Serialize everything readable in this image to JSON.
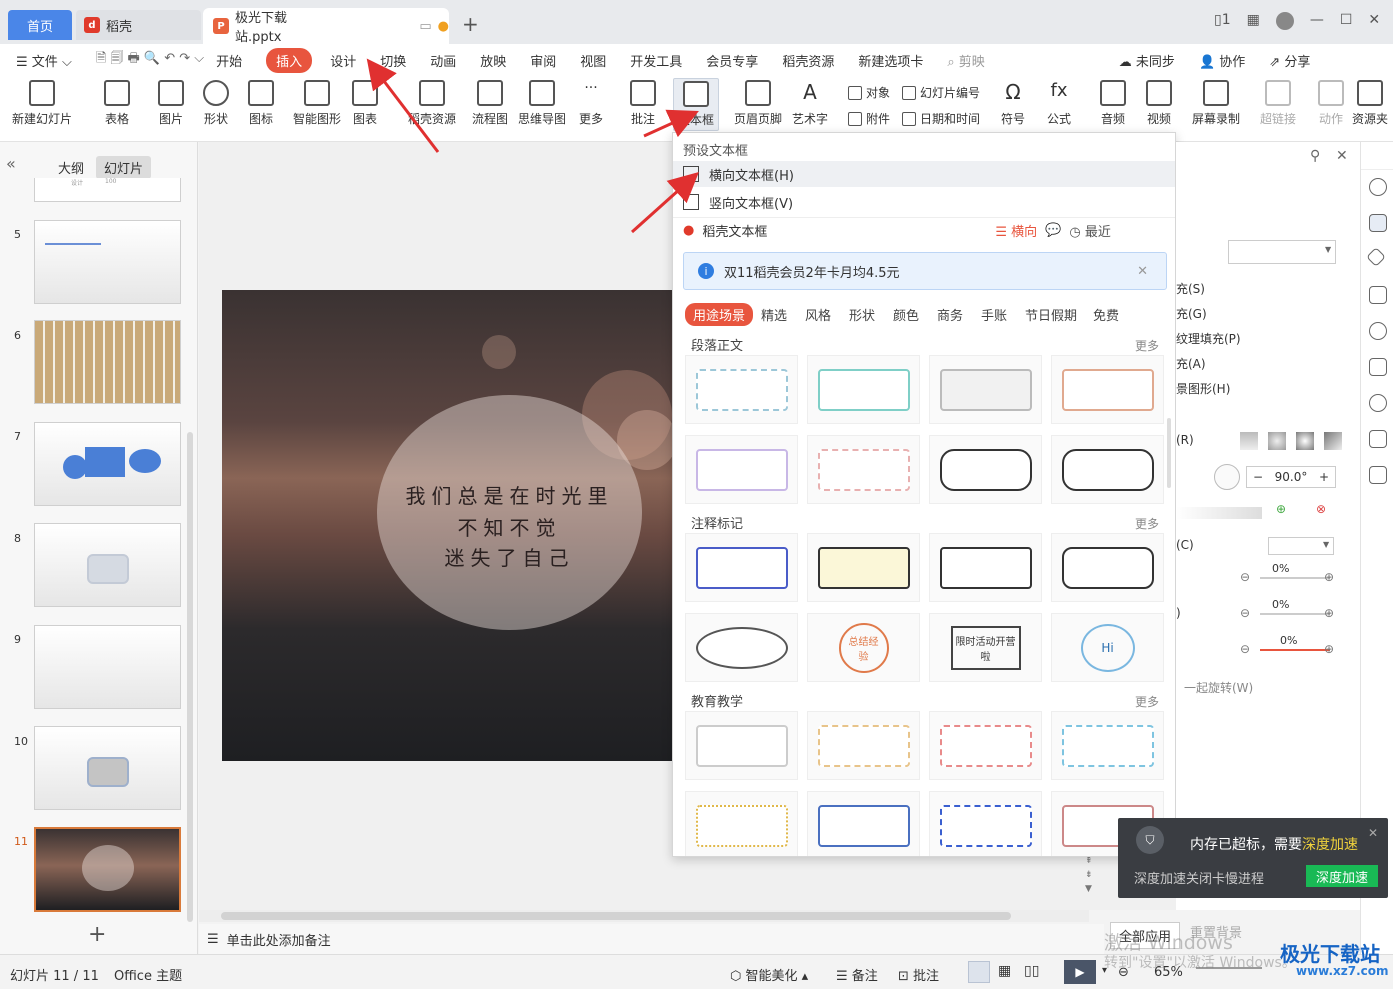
{
  "tabs": {
    "home": "首页",
    "daoke": "稻壳",
    "file": "极光下载站.pptx"
  },
  "menu": {
    "file": "文件",
    "items": [
      "开始",
      "插入",
      "设计",
      "切换",
      "动画",
      "放映",
      "审阅",
      "视图",
      "开发工具",
      "会员专享",
      "稻壳资源",
      "新建选项卡"
    ],
    "active": "插入",
    "search": "剪映",
    "sync": "未同步",
    "collab": "协作",
    "share": "分享"
  },
  "ribbon": {
    "new_slide": "新建幻灯片",
    "table": "表格",
    "image": "图片",
    "shape": "形状",
    "icon": "图标",
    "smart": "智能图形",
    "chart": "图表",
    "daoke_res": "稻壳资源",
    "flow": "流程图",
    "mind": "思维导图",
    "more": "更多",
    "comment": "批注",
    "textbox": "文本框",
    "header": "页眉页脚",
    "art": "艺术字",
    "object": "对象",
    "attach": "附件",
    "slide_no": "幻灯片编号",
    "datetime": "日期和时间",
    "symbol": "符号",
    "formula": "公式",
    "audio": "音频",
    "video": "视频",
    "screenrec": "屏幕录制",
    "hyperlink": "超链接",
    "action": "动作",
    "resource": "资源夹"
  },
  "panel": {
    "outline": "大纲",
    "slides": "幻灯片",
    "numbers": [
      "5",
      "6",
      "7",
      "8",
      "9",
      "10",
      "11"
    ],
    "top_thumb": [
      "设计",
      "100"
    ]
  },
  "slide": {
    "line1": "我们总是在时光里",
    "line2": "不知不觉",
    "line3": "迷失了自己"
  },
  "dropdown": {
    "preset": "预设文本框",
    "horizontal": "横向文本框(H)",
    "vertical": "竖向文本框(V)",
    "daoke": "稻壳文本框",
    "orient": "横向",
    "recent": "最近",
    "banner": "双11稻壳会员2年卡月均4.5元",
    "categories": [
      "用途场景",
      "精选",
      "风格",
      "形状",
      "颜色",
      "商务",
      "手账",
      "节日假期",
      "免费"
    ],
    "sections": [
      "段落正文",
      "注释标记",
      "教育教学"
    ],
    "more": "更多",
    "card_texts": [
      "总结经验",
      "限时活动开营啦",
      "Hi"
    ]
  },
  "rightpanel": {
    "items": [
      "充(S)",
      "充(G)",
      "纹理填充(P)",
      "充(A)",
      "景图形(H)",
      "(R)",
      "(C)",
      ")",
      "一起旋转(W)"
    ],
    "angle": "90.0°",
    "percents": [
      "0%",
      "0%",
      "0%"
    ],
    "apply_all": "全部应用",
    "reset": "重置背景"
  },
  "notes": {
    "placeholder": "单击此处添加备注"
  },
  "status": {
    "slide_count": "幻灯片 11 / 11",
    "theme": "Office 主题",
    "beautify": "智能美化",
    "notes": "备注",
    "comment": "批注",
    "zoom": "65%"
  },
  "toast": {
    "msg": "内存已超标，需要",
    "highlight": "深度加速",
    "sub": "深度加速关闭卡慢进程",
    "btn": "深度加速"
  },
  "watermark": {
    "activate": "激活 Windows",
    "hint": "转到\"设置\"以激活 Windows。",
    "site": "极光下载站",
    "url": "www.xz7.com"
  },
  "colors": {
    "accent": "#e8553e",
    "home_tab": "#4a86e8",
    "toast_btn": "#19b955"
  }
}
